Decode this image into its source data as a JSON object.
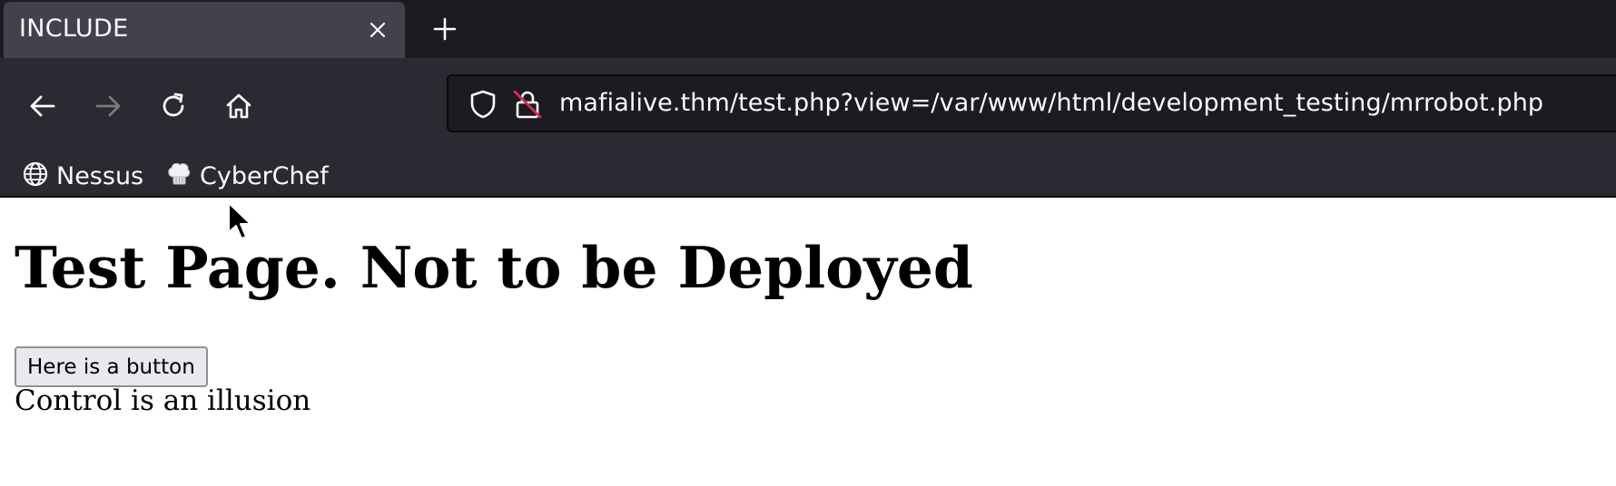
{
  "tab": {
    "title": "INCLUDE",
    "close_icon": "close-icon",
    "new_tab_icon": "plus-icon"
  },
  "nav": {
    "back_icon": "arrow-left-icon",
    "forward_icon": "arrow-right-icon",
    "reload_icon": "reload-icon",
    "home_icon": "home-icon",
    "forward_enabled": false
  },
  "urlbar": {
    "url": "mafialive.thm/test.php?view=/var/www/html/development_testing/mrrobot.php",
    "shield_icon": "shield-icon",
    "lock_icon": "insecure-lock-icon"
  },
  "bookmarks": [
    {
      "label": "Nessus",
      "icon": "globe-icon"
    },
    {
      "label": "CyberChef",
      "icon": "chef-hat-icon"
    }
  ],
  "page": {
    "heading": "Test Page. Not to be Deployed",
    "button_label": "Here is a button",
    "text": "Control is an illusion"
  },
  "colors": {
    "tabstrip_bg": "#1c1b22",
    "tab_bg": "#42414d",
    "navbar_bg": "#2b2a33",
    "urlbar_bg": "#1c1b22",
    "text_light": "#fbfbfe",
    "insecure_accent": "#e22850"
  }
}
